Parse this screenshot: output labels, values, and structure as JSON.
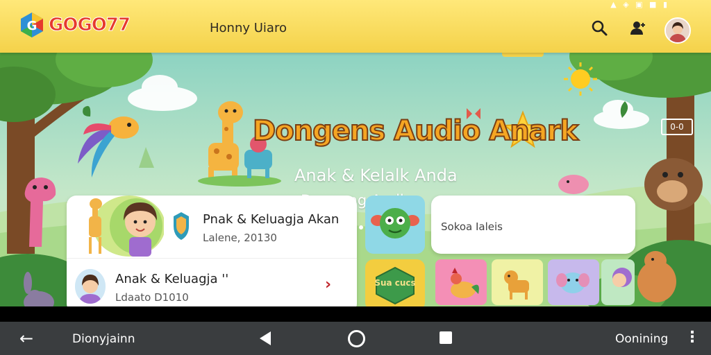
{
  "status_bar": {
    "indicators": "▲ ◈ ▣ ■ ▮"
  },
  "header": {
    "logo_text": "GOGO77",
    "title": "Honny Uiaro",
    "search_icon": "search-icon",
    "account_icon": "account-icon",
    "avatar_icon": "user-avatar"
  },
  "banner": {
    "title": "Dongens Audio Anark",
    "subtitle_line1": "Anak & Kelalk Anda",
    "subtitle_line2": "Dongeng Audio",
    "corner_button": "0-0",
    "page_dots": 3
  },
  "card_featured": {
    "title": "Pnak & Keluagja Akan",
    "subtitle": "Lalene, 20130",
    "row_title": "Anak & Keluagja ''",
    "row_subtitle": "Ldaato D1010"
  },
  "tiles": {
    "sign_text": "Sua cucs"
  },
  "card_secondary": {
    "text": "Sokoa Ialeis"
  },
  "navbar": {
    "left_label": "Dionyjainn",
    "right_label": "Oonining",
    "back_icon": "←",
    "more_icon": "⋮"
  },
  "colors": {
    "header": "#f4d24a",
    "banner_title": "#f5a623",
    "navbar": "#3a3d3f"
  }
}
